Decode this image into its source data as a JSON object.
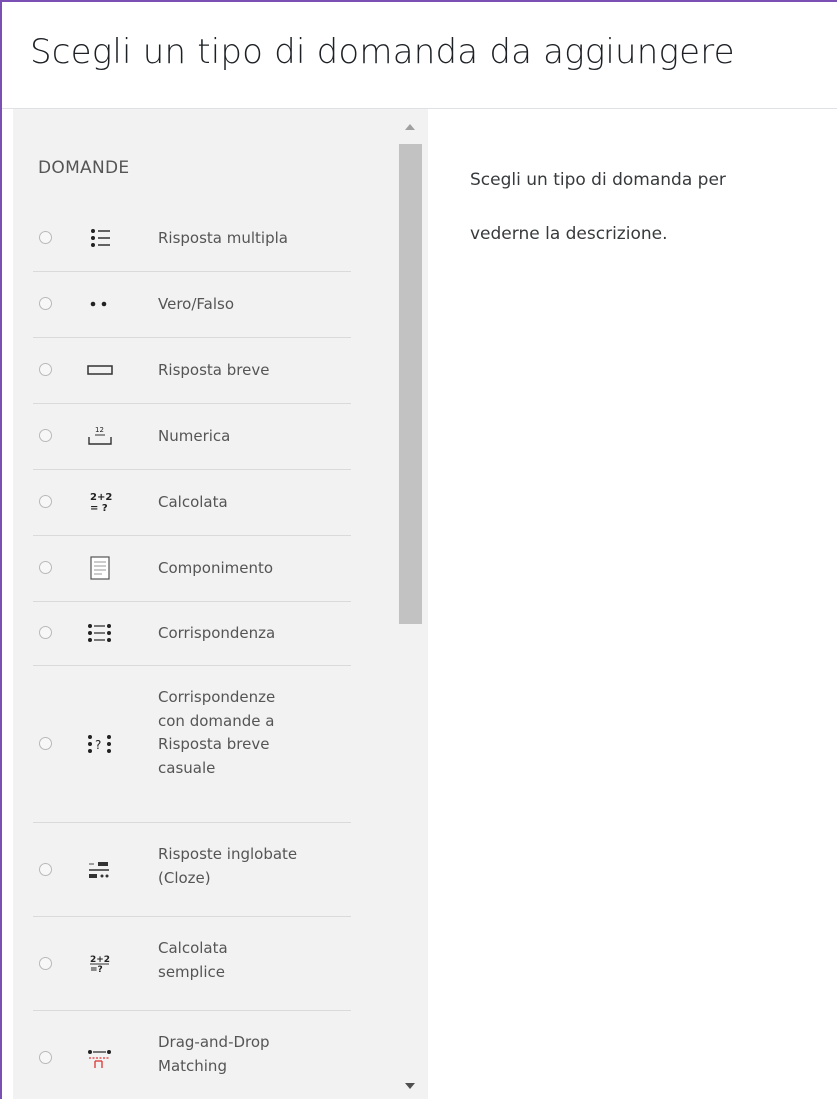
{
  "dialog": {
    "title": "Scegli un tipo di domanda da aggiungere"
  },
  "panel": {
    "section_label": "DOMANDE",
    "items": [
      {
        "label": "Risposta multipla",
        "icon": "multichoice-icon"
      },
      {
        "label": "Vero/Falso",
        "icon": "truefalse-icon"
      },
      {
        "label": "Risposta breve",
        "icon": "shortanswer-icon"
      },
      {
        "label": "Numerica",
        "icon": "numerical-icon"
      },
      {
        "label": "Calcolata",
        "icon": "calculated-icon"
      },
      {
        "label": "Componimento",
        "icon": "essay-icon"
      },
      {
        "label": "Corrispondenza",
        "icon": "match-icon"
      },
      {
        "label": "Corrispondenze con domande a Risposta breve casuale",
        "icon": "randomsamatch-icon"
      },
      {
        "label": "Risposte inglobate (Cloze)",
        "icon": "multianswer-icon"
      },
      {
        "label": "Calcolata semplice",
        "icon": "calculatedsimple-icon"
      },
      {
        "label": "Drag-and-Drop Matching",
        "icon": "ddmatch-icon"
      }
    ]
  },
  "description": {
    "line1": "Scegli un tipo di domanda per",
    "line2": "vederne la descrizione."
  }
}
